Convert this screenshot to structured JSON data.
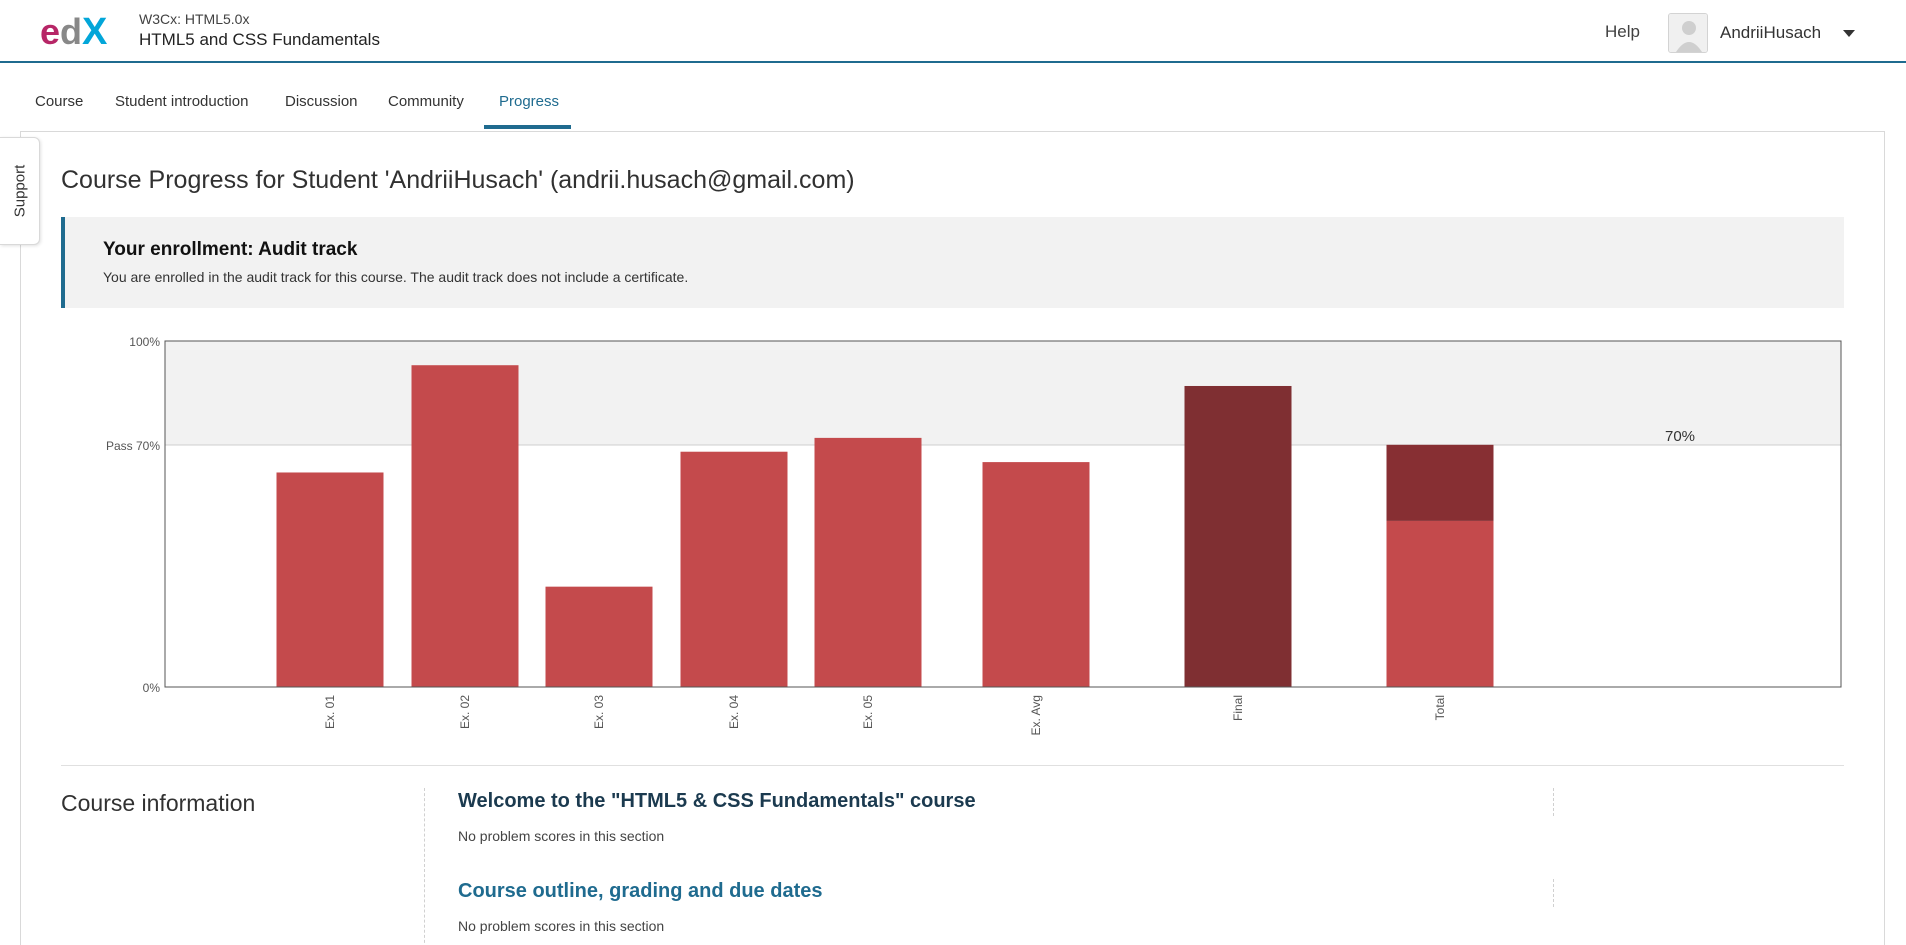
{
  "header": {
    "logo_text": "edX",
    "course_org": "W3Cx: HTML5.0x",
    "course_name": "HTML5 and CSS Fundamentals",
    "help_label": "Help",
    "username": "AndriiHusach"
  },
  "tabs": [
    {
      "label": "Course"
    },
    {
      "label": "Student introduction"
    },
    {
      "label": "Discussion"
    },
    {
      "label": "Community"
    },
    {
      "label": "Progress",
      "active": true
    }
  ],
  "support_label": "Support",
  "page_title": "Course Progress for Student 'AndriiHusach' (andrii.husach@gmail.com)",
  "enrollment": {
    "title": "Your enrollment: Audit track",
    "text": "You are enrolled in the audit track for this course. The audit track does not include a certificate."
  },
  "chart_data": {
    "type": "bar",
    "y_tick_labels": [
      "100%",
      "Pass 70%",
      "0%"
    ],
    "ylim": [
      0,
      100
    ],
    "pass_line": 70,
    "categories": [
      "Ex. 01",
      "Ex. 02",
      "Ex. 03",
      "Ex. 04",
      "Ex. 05",
      "Ex. Avg",
      "Final",
      "Total"
    ],
    "values": [
      62,
      93,
      29,
      68,
      72,
      65,
      87,
      70
    ],
    "total_stack": {
      "lower": 48,
      "upper": 22
    },
    "total_label": "70%",
    "colors": {
      "exercise": "#c44a4c",
      "final": "#7f2f32",
      "total_upper": "#872f33",
      "pass_band": "#f2f2f2"
    }
  },
  "course_info": {
    "title": "Course information",
    "sections": [
      {
        "title": "Welcome to the \"HTML5 & CSS Fundamentals\" course",
        "note": "No problem scores in this section"
      },
      {
        "title": "Course outline, grading and due dates",
        "note": "No problem scores in this section"
      }
    ]
  }
}
